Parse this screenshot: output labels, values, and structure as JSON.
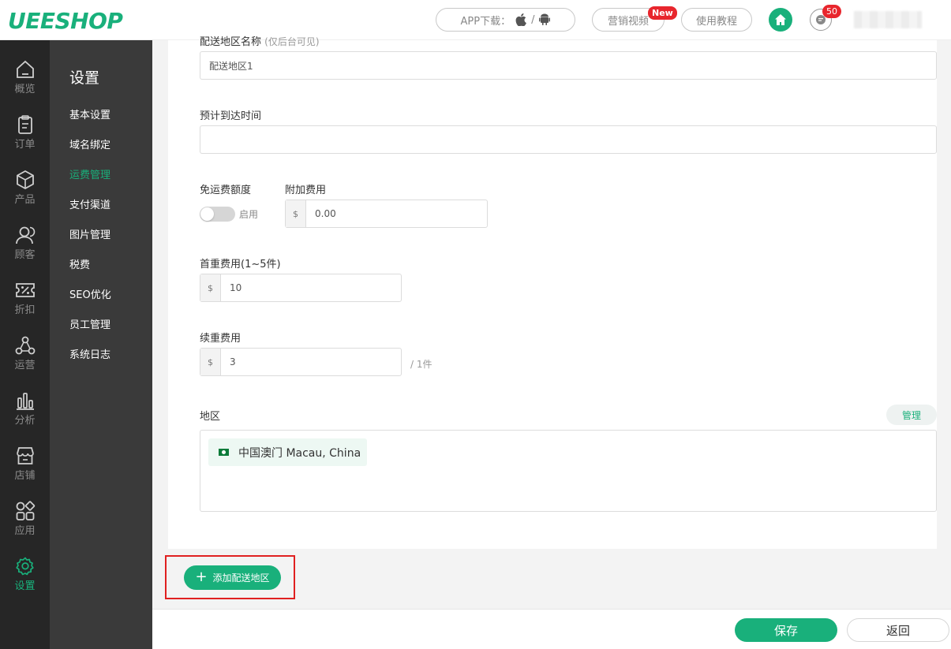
{
  "brand": {
    "logo": "UEESHOP",
    "accent": "#19b07b",
    "badge_color": "#e8262d"
  },
  "topbar": {
    "app_download_label": "APP下载：",
    "app_separator": "/",
    "marketing_video_label": "营销视频",
    "new_badge": "New",
    "tutorial_label": "使用教程",
    "message_count": "50"
  },
  "rail": [
    {
      "label": "概览",
      "icon": "home-outline-icon"
    },
    {
      "label": "订单",
      "icon": "clipboard-icon"
    },
    {
      "label": "产品",
      "icon": "cube-icon"
    },
    {
      "label": "顾客",
      "icon": "users-icon"
    },
    {
      "label": "折扣",
      "icon": "percent-ticket-icon"
    },
    {
      "label": "运营",
      "icon": "network-icon"
    },
    {
      "label": "分析",
      "icon": "bar-chart-icon"
    },
    {
      "label": "店铺",
      "icon": "store-icon"
    },
    {
      "label": "应用",
      "icon": "apps-icon"
    },
    {
      "label": "设置",
      "icon": "gear-icon",
      "active": true
    }
  ],
  "submenu": {
    "title": "设置",
    "items": [
      "基本设置",
      "域名绑定",
      "运费管理",
      "支付渠道",
      "图片管理",
      "税费",
      "SEO优化",
      "员工管理",
      "系统日志"
    ],
    "active": "运费管理"
  },
  "form": {
    "zone_name_label": "配送地区名称",
    "zone_name_hint": "(仅后台可见)",
    "zone_name_value": "配送地区1",
    "eta_label": "预计到达时间",
    "eta_value": "",
    "free_shipping_label": "免运费额度",
    "free_shipping_toggle_text": "启用",
    "extra_fee_label": "附加费用",
    "currency": "$",
    "extra_fee_value": "0.00",
    "first_weight_label": "首重费用(1~5件)",
    "first_weight_value": "10",
    "continued_weight_label": "续重费用",
    "continued_weight_value": "3",
    "continued_suffix": "/ 1件",
    "region_label": "地区",
    "manage_label": "管理",
    "regions": [
      {
        "name": "中国澳门  Macau, China",
        "flag": "macau-flag-icon"
      }
    ]
  },
  "actions": {
    "add_zone_label": "添加配送地区",
    "save_label": "保存",
    "back_label": "返回"
  }
}
